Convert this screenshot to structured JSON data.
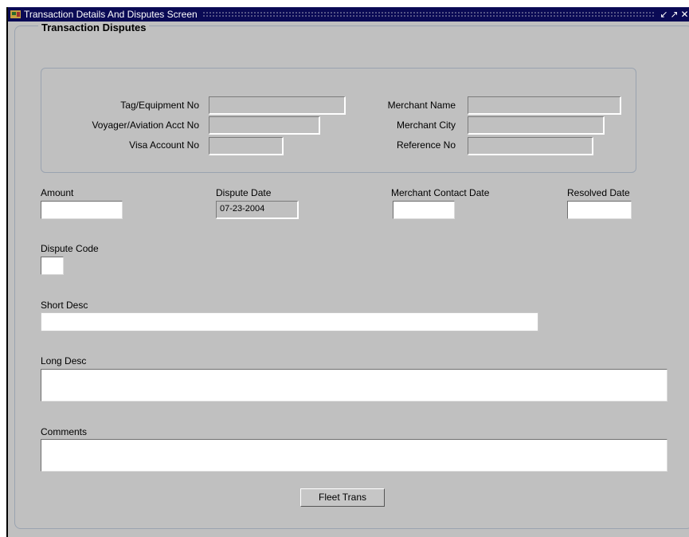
{
  "window": {
    "title": "Transaction Details And Disputes Screen",
    "controls": [
      "minimize-icon",
      "maximize-icon",
      "close-icon"
    ]
  },
  "group": {
    "title": "Transaction Disputes"
  },
  "fields": {
    "tag_equipment_no": {
      "label": "Tag/Equipment No",
      "value": ""
    },
    "voyager_aviation_acct_no": {
      "label": "Voyager/Aviation Acct No",
      "value": ""
    },
    "visa_account_no": {
      "label": "Visa Account No",
      "value": ""
    },
    "merchant_name": {
      "label": "Merchant Name",
      "value": ""
    },
    "merchant_city": {
      "label": "Merchant City",
      "value": ""
    },
    "reference_no": {
      "label": "Reference No",
      "value": ""
    },
    "amount": {
      "label": "Amount",
      "value": ""
    },
    "dispute_date": {
      "label": "Dispute Date",
      "value": "07-23-2004"
    },
    "merchant_contact_date": {
      "label": "Merchant Contact Date",
      "value": ""
    },
    "resolved_date": {
      "label": "Resolved Date",
      "value": ""
    },
    "dispute_code": {
      "label": "Dispute Code",
      "value": ""
    },
    "short_desc": {
      "label": "Short Desc",
      "value": ""
    },
    "long_desc": {
      "label": "Long Desc",
      "value": ""
    },
    "comments": {
      "label": "Comments",
      "value": ""
    }
  },
  "buttons": {
    "fleet_trans": "Fleet Trans"
  }
}
